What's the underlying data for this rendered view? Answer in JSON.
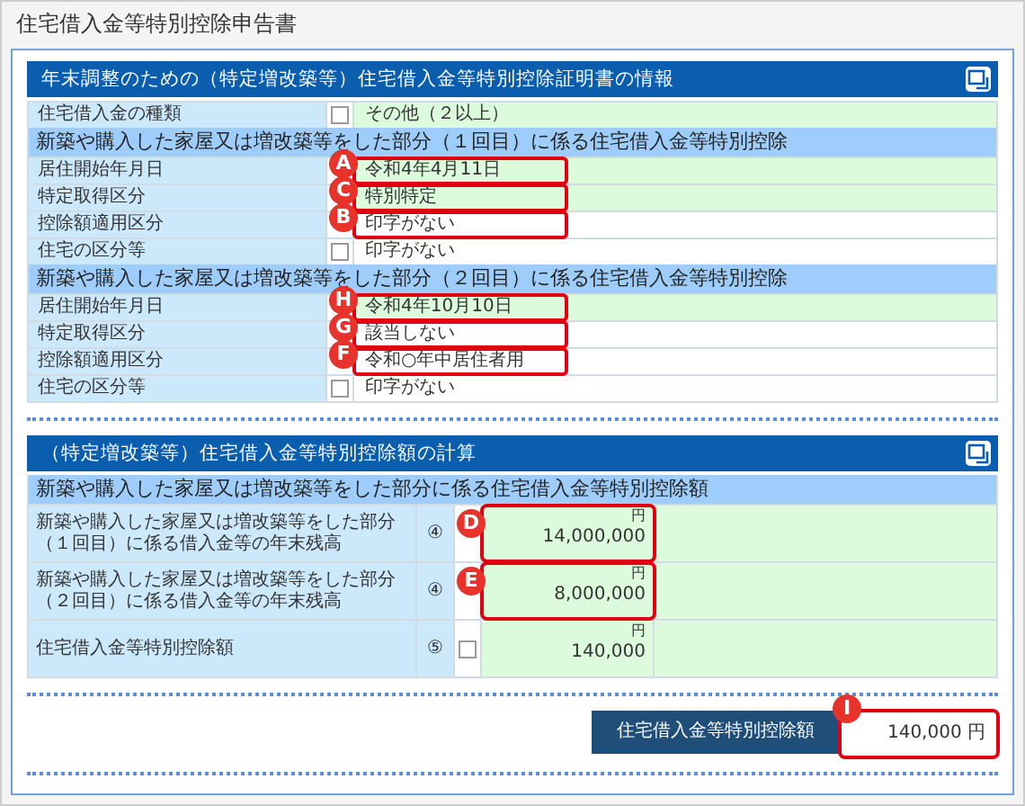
{
  "title": "住宅借入金等特別控除申告書",
  "sections": [
    {
      "kind": "info",
      "heading": "年末調整のための（特定増改築等）住宅借入金等特別控除証明書の情報",
      "groups": [
        {
          "rows": [
            {
              "label": "住宅借入金の種類",
              "checked": false,
              "value": "その他（２以上）",
              "shaded": true
            }
          ]
        },
        {
          "subheading": "新築や購入した家屋又は増改築等をした部分（１回目）に係る住宅借入金等特別控除",
          "rows": [
            {
              "label": "居住開始年月日",
              "value": "令和4年4月11日",
              "shaded": true,
              "marker": "A"
            },
            {
              "label": "特定取得区分",
              "value": "特別特定",
              "shaded": true,
              "marker": "C"
            },
            {
              "label": "控除額適用区分",
              "value": "印字がない",
              "shaded": false,
              "marker": "B"
            },
            {
              "label": "住宅の区分等",
              "checked": false,
              "value": "印字がない",
              "shaded": false
            }
          ]
        },
        {
          "subheading": "新築や購入した家屋又は増改築等をした部分（２回目）に係る住宅借入金等特別控除",
          "rows": [
            {
              "label": "居住開始年月日",
              "value": "令和4年10月10日",
              "shaded": true,
              "marker": "H"
            },
            {
              "label": "特定取得区分",
              "value": "該当しない",
              "shaded": false,
              "marker": "G"
            },
            {
              "label": "控除額適用区分",
              "value": "令和○年中居住者用",
              "shaded": false,
              "marker": "F"
            },
            {
              "label": "住宅の区分等",
              "checked": false,
              "value": "印字がない",
              "shaded": false
            }
          ]
        }
      ]
    },
    {
      "kind": "calc",
      "heading": "（特定増改築等）住宅借入金等特別控除額の計算",
      "groups": [
        {
          "subheading": "新築や購入した家屋又は増改築等をした部分に係る住宅借入金等特別控除額",
          "rows": [
            {
              "label": "新築や購入した家屋又は増改築等をした部分（１回目）に係る借入金等の年末残高",
              "number": "④",
              "unit": "円",
              "value": "14,000,000",
              "shaded": true,
              "marker": "D"
            },
            {
              "label": "新築や購入した家屋又は増改築等をした部分（２回目）に係る借入金等の年末残高",
              "number": "④",
              "unit": "円",
              "value": "8,000,000",
              "shaded": true,
              "marker": "E"
            },
            {
              "label": "住宅借入金等特別控除額",
              "number": "⑤",
              "checked": false,
              "unit": "円",
              "value": "140,000",
              "shaded": true
            }
          ]
        }
      ]
    }
  ],
  "total": {
    "label": "住宅借入金等特別控除額",
    "value": "140,000 円",
    "marker": "I"
  }
}
